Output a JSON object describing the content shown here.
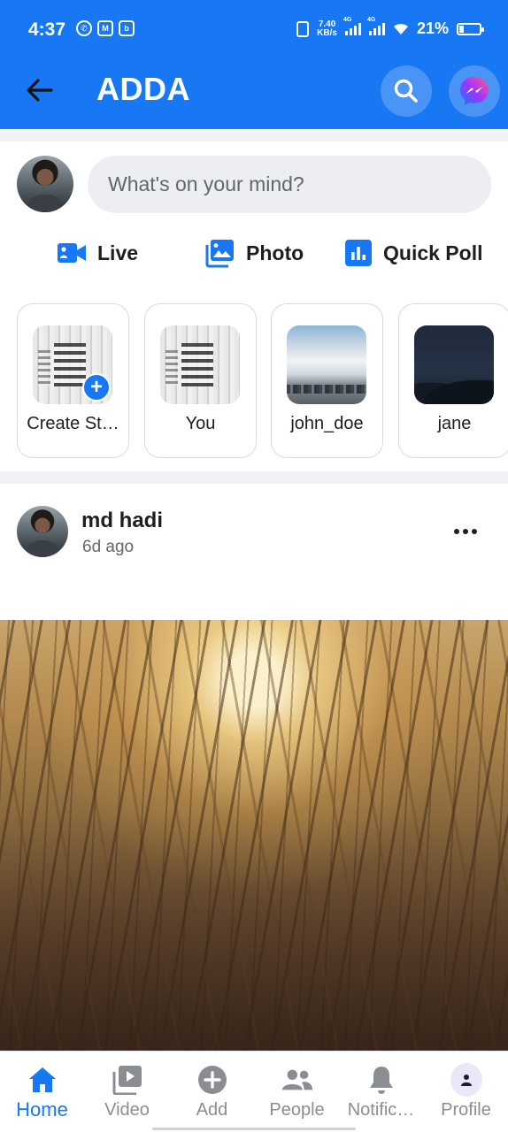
{
  "status_bar": {
    "time": "4:37",
    "net_speed": "7.40",
    "net_unit": "KB/s",
    "signal1_tag": "4G",
    "signal2_tag": "4G",
    "battery_percent": "21%",
    "battery_level": 0.21
  },
  "app_bar": {
    "title": "ADDA",
    "back_icon": "arrow-left-icon",
    "search_icon": "search-icon",
    "messenger_icon": "messenger-icon",
    "bg_color": "#1877f2"
  },
  "composer": {
    "placeholder": "What's on your mind?"
  },
  "actions": {
    "live": "Live",
    "photo": "Photo",
    "quick_poll": "Quick Poll"
  },
  "stories": [
    {
      "label": "Create St…"
    },
    {
      "label": "You"
    },
    {
      "label": "john_doe"
    },
    {
      "label": "jane"
    }
  ],
  "post": {
    "author": "md hadi",
    "time": "6d ago"
  },
  "bottom_nav": [
    {
      "label": "Home",
      "icon": "home-icon",
      "active": true
    },
    {
      "label": "Video",
      "icon": "video-icon",
      "active": false
    },
    {
      "label": "Add",
      "icon": "add-icon",
      "active": false
    },
    {
      "label": "People",
      "icon": "people-icon",
      "active": false
    },
    {
      "label": "Notific…",
      "icon": "bell-icon",
      "active": false
    },
    {
      "label": "Profile",
      "icon": "profile-icon",
      "active": false
    }
  ],
  "colors": {
    "accent": "#1877f2",
    "nav_inactive": "#8a8d91",
    "background_gap": "#f0f2f5"
  }
}
